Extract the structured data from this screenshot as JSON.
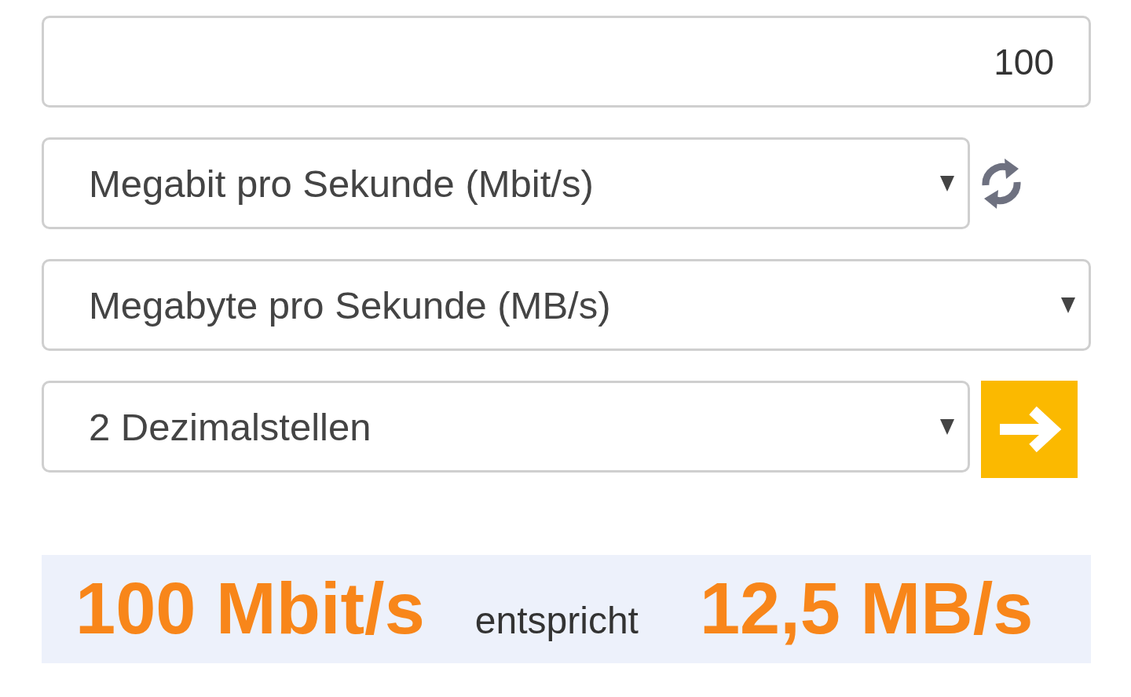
{
  "amount_field": {
    "value": "100"
  },
  "from_unit": {
    "value": "Megabit pro Sekunde (Mbit/s)"
  },
  "to_unit": {
    "value": "Megabyte pro Sekunde (MB/s)"
  },
  "precision": {
    "value": "2 Dezimalstellen"
  },
  "result": {
    "input": "100 Mbit/s",
    "connector": "entspricht",
    "output": "12,5 MB/s"
  }
}
